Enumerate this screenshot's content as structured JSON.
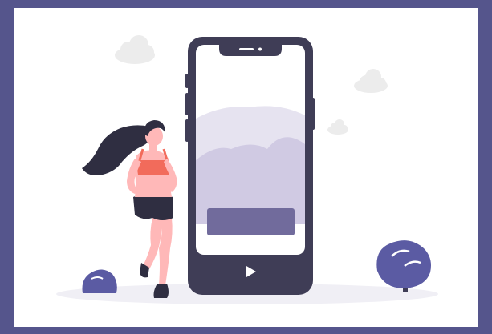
{
  "illustration": {
    "subject": "woman-running-beside-phone-video",
    "colors": {
      "frame_border": "#55558c",
      "card_background": "#ffffff",
      "phone_body": "#3f3d56",
      "phone_screen": "#ffffff",
      "mountain_back": "#e6e3f0",
      "mountain_front": "#d0cae3",
      "screen_bar": "#716b9c",
      "bush": "#5b5ba3",
      "ground_shadow": "#f0eff5",
      "cloud": "#ececec",
      "skin": "#ffb8b8",
      "top": "#f26b5b",
      "hair": "#2f2e41",
      "shorts": "#2f2e41"
    },
    "icons": [
      "play-icon",
      "cloud-icon",
      "bush-icon"
    ]
  }
}
